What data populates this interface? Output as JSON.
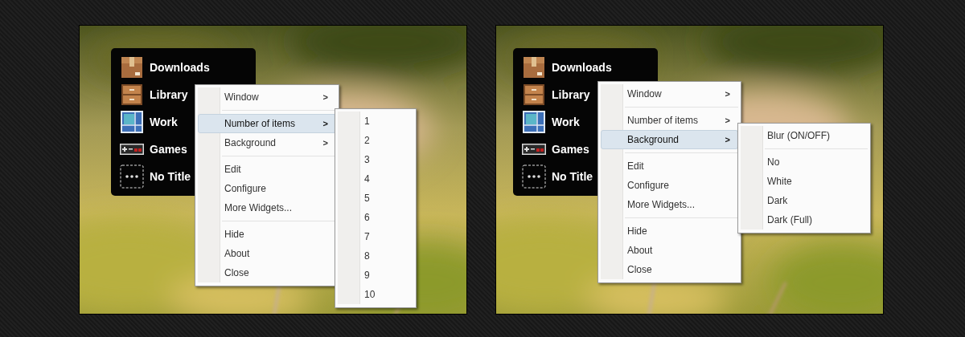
{
  "panels": [
    {
      "widget": {
        "items": [
          {
            "label": "Downloads",
            "kind": "box"
          },
          {
            "label": "Library",
            "kind": "drawers"
          },
          {
            "label": "Work",
            "kind": "grid"
          },
          {
            "label": "Games",
            "kind": "gamepad"
          },
          {
            "label": "No Title",
            "kind": "dots"
          }
        ]
      },
      "menu": {
        "items": [
          {
            "kind": "item",
            "label": "Window",
            "arrow": ">",
            "selected": false
          },
          {
            "kind": "separator"
          },
          {
            "kind": "item",
            "label": "Number of items",
            "arrow": ">",
            "selected": true
          },
          {
            "kind": "item",
            "label": "Background",
            "arrow": ">",
            "selected": false
          },
          {
            "kind": "separator"
          },
          {
            "kind": "item",
            "label": "Edit",
            "selected": false
          },
          {
            "kind": "item",
            "label": "Configure",
            "selected": false
          },
          {
            "kind": "item",
            "label": "More Widgets...",
            "selected": false
          },
          {
            "kind": "separator"
          },
          {
            "kind": "item",
            "label": "Hide",
            "selected": false
          },
          {
            "kind": "item",
            "label": "About",
            "selected": false
          },
          {
            "kind": "item",
            "label": "Close",
            "selected": false
          }
        ]
      },
      "submenu": {
        "items": [
          {
            "kind": "item",
            "label": "1",
            "selected": false
          },
          {
            "kind": "item",
            "label": "2",
            "selected": false
          },
          {
            "kind": "item",
            "label": "3",
            "selected": false
          },
          {
            "kind": "item",
            "label": "4",
            "selected": false
          },
          {
            "kind": "item",
            "label": "5",
            "selected": false
          },
          {
            "kind": "item",
            "label": "6",
            "selected": false
          },
          {
            "kind": "item",
            "label": "7",
            "selected": false
          },
          {
            "kind": "item",
            "label": "8",
            "selected": false
          },
          {
            "kind": "item",
            "label": "9",
            "selected": false
          },
          {
            "kind": "item",
            "label": "10",
            "selected": false
          }
        ]
      }
    },
    {
      "widget": {
        "items": [
          {
            "label": "Downloads",
            "kind": "box"
          },
          {
            "label": "Library",
            "kind": "drawers"
          },
          {
            "label": "Work",
            "kind": "grid"
          },
          {
            "label": "Games",
            "kind": "gamepad"
          },
          {
            "label": "No Title",
            "kind": "dots"
          }
        ]
      },
      "menu": {
        "items": [
          {
            "kind": "item",
            "label": "Window",
            "arrow": ">",
            "selected": false
          },
          {
            "kind": "separator"
          },
          {
            "kind": "item",
            "label": "Number of items",
            "arrow": ">",
            "selected": false
          },
          {
            "kind": "item",
            "label": "Background",
            "arrow": ">",
            "selected": true
          },
          {
            "kind": "separator"
          },
          {
            "kind": "item",
            "label": "Edit",
            "selected": false
          },
          {
            "kind": "item",
            "label": "Configure",
            "selected": false
          },
          {
            "kind": "item",
            "label": "More Widgets...",
            "selected": false
          },
          {
            "kind": "separator"
          },
          {
            "kind": "item",
            "label": "Hide",
            "selected": false
          },
          {
            "kind": "item",
            "label": "About",
            "selected": false
          },
          {
            "kind": "item",
            "label": "Close",
            "selected": false
          }
        ]
      },
      "submenu": {
        "items": [
          {
            "kind": "item",
            "label": "Blur (ON/OFF)",
            "selected": false
          },
          {
            "kind": "separator"
          },
          {
            "kind": "item",
            "label": "No",
            "selected": false
          },
          {
            "kind": "item",
            "label": "White",
            "selected": false
          },
          {
            "kind": "item",
            "label": "Dark",
            "selected": false
          },
          {
            "kind": "item",
            "label": "Dark (Full)",
            "selected": false
          }
        ]
      }
    }
  ]
}
